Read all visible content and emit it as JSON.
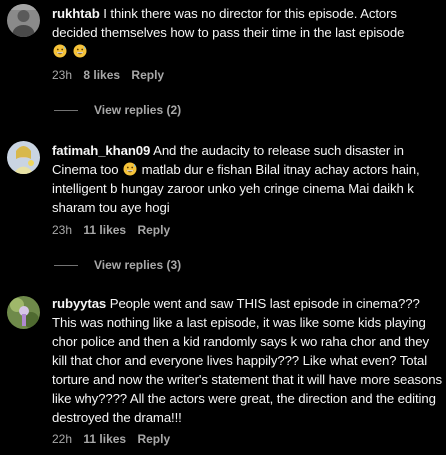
{
  "comments": [
    {
      "username": "rukhtab",
      "text": "I think there was no director for this episode. Actors decided themselves how to pass their time in the last episode",
      "emojis": [
        "grinning-sweat-emoji",
        "grinning-sweat-emoji"
      ],
      "time": "23h",
      "likes": "8 likes",
      "reply": "Reply",
      "view_replies": "View replies (2)"
    },
    {
      "username": "fatimah_khan09",
      "text_before_emoji": "And the audacity to release such disaster in Cinema too",
      "text_after_emoji": "matlab dur e fishan Bilal itnay achay actors hain, intelligent b hungay zaroor unko yeh cringe cinema Mai daikh k sharam tou aye hogi",
      "emoji": "grinning-sweat-emoji",
      "time": "23h",
      "likes": "11 likes",
      "reply": "Reply",
      "view_replies": "View replies (3)"
    },
    {
      "username": "rubyytas",
      "text": "People went and saw THIS last episode in cinema??? This was nothing like a last episode, it was like some kids playing chor police and then a kid randomly says k wo raha chor and they kill that chor and everyone lives happily??? Like what even? Total torture and now the writer's statement that it will have more seasons like why???? All the actors were great, the direction and the editing destroyed the drama!!!",
      "time": "22h",
      "likes": "11 likes",
      "reply": "Reply"
    }
  ],
  "colors": {
    "background": "#000000",
    "primary_text": "#f5f5f5",
    "secondary_text": "#a8a8a8",
    "emoji_face": "#f6c33a"
  }
}
